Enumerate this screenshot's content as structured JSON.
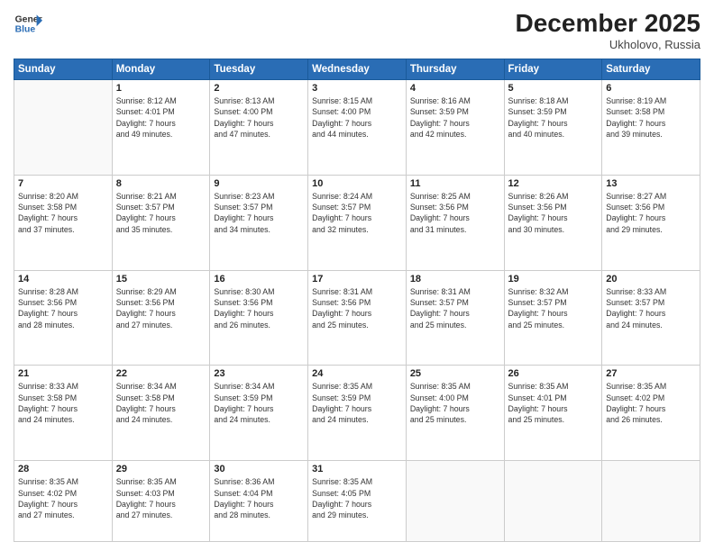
{
  "header": {
    "logo_line1": "General",
    "logo_line2": "Blue",
    "month_title": "December 2025",
    "location": "Ukholovo, Russia"
  },
  "days_of_week": [
    "Sunday",
    "Monday",
    "Tuesday",
    "Wednesday",
    "Thursday",
    "Friday",
    "Saturday"
  ],
  "weeks": [
    [
      {
        "day": "",
        "info": ""
      },
      {
        "day": "1",
        "info": "Sunrise: 8:12 AM\nSunset: 4:01 PM\nDaylight: 7 hours\nand 49 minutes."
      },
      {
        "day": "2",
        "info": "Sunrise: 8:13 AM\nSunset: 4:00 PM\nDaylight: 7 hours\nand 47 minutes."
      },
      {
        "day": "3",
        "info": "Sunrise: 8:15 AM\nSunset: 4:00 PM\nDaylight: 7 hours\nand 44 minutes."
      },
      {
        "day": "4",
        "info": "Sunrise: 8:16 AM\nSunset: 3:59 PM\nDaylight: 7 hours\nand 42 minutes."
      },
      {
        "day": "5",
        "info": "Sunrise: 8:18 AM\nSunset: 3:59 PM\nDaylight: 7 hours\nand 40 minutes."
      },
      {
        "day": "6",
        "info": "Sunrise: 8:19 AM\nSunset: 3:58 PM\nDaylight: 7 hours\nand 39 minutes."
      }
    ],
    [
      {
        "day": "7",
        "info": "Sunrise: 8:20 AM\nSunset: 3:58 PM\nDaylight: 7 hours\nand 37 minutes."
      },
      {
        "day": "8",
        "info": "Sunrise: 8:21 AM\nSunset: 3:57 PM\nDaylight: 7 hours\nand 35 minutes."
      },
      {
        "day": "9",
        "info": "Sunrise: 8:23 AM\nSunset: 3:57 PM\nDaylight: 7 hours\nand 34 minutes."
      },
      {
        "day": "10",
        "info": "Sunrise: 8:24 AM\nSunset: 3:57 PM\nDaylight: 7 hours\nand 32 minutes."
      },
      {
        "day": "11",
        "info": "Sunrise: 8:25 AM\nSunset: 3:56 PM\nDaylight: 7 hours\nand 31 minutes."
      },
      {
        "day": "12",
        "info": "Sunrise: 8:26 AM\nSunset: 3:56 PM\nDaylight: 7 hours\nand 30 minutes."
      },
      {
        "day": "13",
        "info": "Sunrise: 8:27 AM\nSunset: 3:56 PM\nDaylight: 7 hours\nand 29 minutes."
      }
    ],
    [
      {
        "day": "14",
        "info": "Sunrise: 8:28 AM\nSunset: 3:56 PM\nDaylight: 7 hours\nand 28 minutes."
      },
      {
        "day": "15",
        "info": "Sunrise: 8:29 AM\nSunset: 3:56 PM\nDaylight: 7 hours\nand 27 minutes."
      },
      {
        "day": "16",
        "info": "Sunrise: 8:30 AM\nSunset: 3:56 PM\nDaylight: 7 hours\nand 26 minutes."
      },
      {
        "day": "17",
        "info": "Sunrise: 8:31 AM\nSunset: 3:56 PM\nDaylight: 7 hours\nand 25 minutes."
      },
      {
        "day": "18",
        "info": "Sunrise: 8:31 AM\nSunset: 3:57 PM\nDaylight: 7 hours\nand 25 minutes."
      },
      {
        "day": "19",
        "info": "Sunrise: 8:32 AM\nSunset: 3:57 PM\nDaylight: 7 hours\nand 25 minutes."
      },
      {
        "day": "20",
        "info": "Sunrise: 8:33 AM\nSunset: 3:57 PM\nDaylight: 7 hours\nand 24 minutes."
      }
    ],
    [
      {
        "day": "21",
        "info": "Sunrise: 8:33 AM\nSunset: 3:58 PM\nDaylight: 7 hours\nand 24 minutes."
      },
      {
        "day": "22",
        "info": "Sunrise: 8:34 AM\nSunset: 3:58 PM\nDaylight: 7 hours\nand 24 minutes."
      },
      {
        "day": "23",
        "info": "Sunrise: 8:34 AM\nSunset: 3:59 PM\nDaylight: 7 hours\nand 24 minutes."
      },
      {
        "day": "24",
        "info": "Sunrise: 8:35 AM\nSunset: 3:59 PM\nDaylight: 7 hours\nand 24 minutes."
      },
      {
        "day": "25",
        "info": "Sunrise: 8:35 AM\nSunset: 4:00 PM\nDaylight: 7 hours\nand 25 minutes."
      },
      {
        "day": "26",
        "info": "Sunrise: 8:35 AM\nSunset: 4:01 PM\nDaylight: 7 hours\nand 25 minutes."
      },
      {
        "day": "27",
        "info": "Sunrise: 8:35 AM\nSunset: 4:02 PM\nDaylight: 7 hours\nand 26 minutes."
      }
    ],
    [
      {
        "day": "28",
        "info": "Sunrise: 8:35 AM\nSunset: 4:02 PM\nDaylight: 7 hours\nand 27 minutes."
      },
      {
        "day": "29",
        "info": "Sunrise: 8:35 AM\nSunset: 4:03 PM\nDaylight: 7 hours\nand 27 minutes."
      },
      {
        "day": "30",
        "info": "Sunrise: 8:36 AM\nSunset: 4:04 PM\nDaylight: 7 hours\nand 28 minutes."
      },
      {
        "day": "31",
        "info": "Sunrise: 8:35 AM\nSunset: 4:05 PM\nDaylight: 7 hours\nand 29 minutes."
      },
      {
        "day": "",
        "info": ""
      },
      {
        "day": "",
        "info": ""
      },
      {
        "day": "",
        "info": ""
      }
    ]
  ]
}
